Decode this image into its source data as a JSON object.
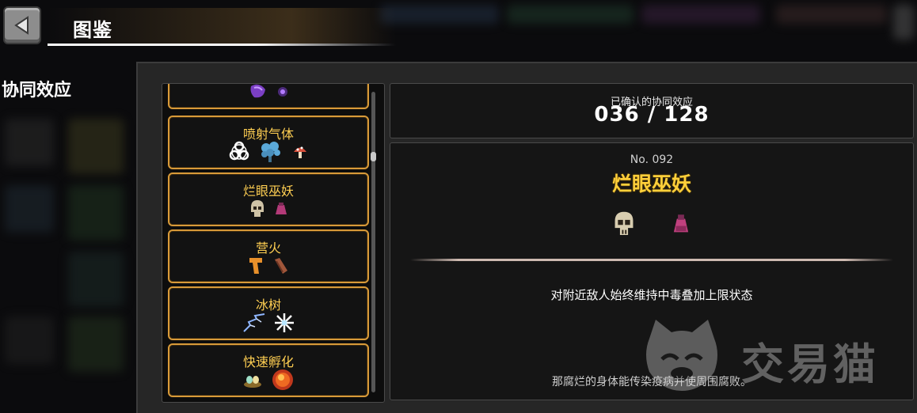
{
  "header": {
    "title": "图鉴"
  },
  "sidebar": {
    "section_label": "协同效应"
  },
  "synergy_list": {
    "items": [
      {
        "name": "",
        "icons": [
          "purple-orb-icon",
          "small-purple-orb-icon"
        ]
      },
      {
        "name": "喷射气体",
        "icons": [
          "biohazard-icon",
          "blue-mushroom-cluster-icon",
          "red-mushroom-icon"
        ]
      },
      {
        "name": "烂眼巫妖",
        "icons": [
          "skull-icon",
          "pink-potion-icon"
        ]
      },
      {
        "name": "营火",
        "icons": [
          "boomerang-icon",
          "wood-log-icon"
        ]
      },
      {
        "name": "冰树",
        "icons": [
          "lightning-branch-icon",
          "snowflake-icon"
        ]
      },
      {
        "name": "快速孵化",
        "icons": [
          "egg-nest-icon",
          "fire-orb-icon"
        ]
      }
    ]
  },
  "counter": {
    "label": "已确认的协同效应",
    "value": "036 / 128"
  },
  "detail": {
    "number": "No. 092",
    "name": "烂眼巫妖",
    "icons": [
      "skull-icon",
      "pink-potion-icon"
    ],
    "effect": "对附近敌人始终维持中毒叠加上限状态",
    "flavor": "那腐烂的身体能传染疫病并使周围腐败。"
  },
  "watermark": {
    "text": "交易猫"
  },
  "colors": {
    "accent_gold": "#ffcf3a",
    "item_border": "#d89a39",
    "panel_bg": "#151515"
  }
}
